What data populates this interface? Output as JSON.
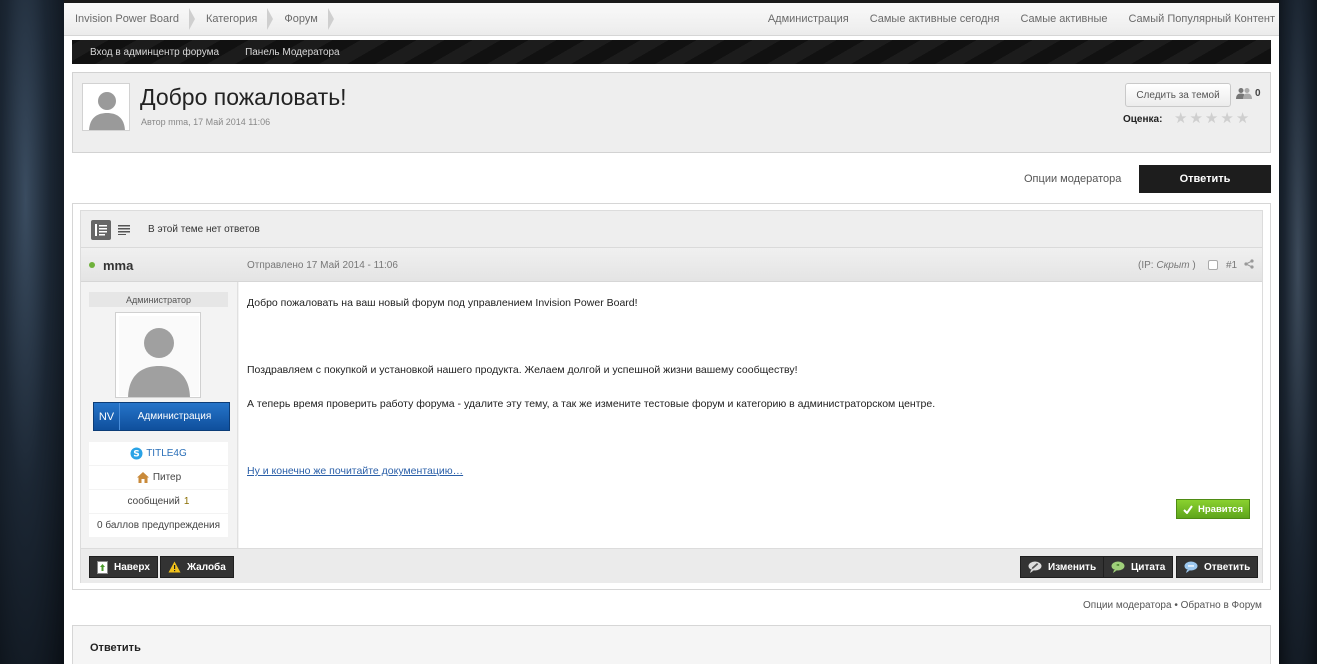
{
  "breadcrumbs": [
    "Invision Power Board",
    "Категория",
    "Форум"
  ],
  "top_links": [
    "Администрация",
    "Самые активные сегодня",
    "Самые активные",
    "Самый Популярный Контент"
  ],
  "sub_bar": {
    "admin_link": "Вход в админцентр форума",
    "mod_link": "Панель Модератора"
  },
  "topic": {
    "title": "Добро пожаловать!",
    "meta": "Автор mma, 17 Май 2014 11:06",
    "follow_label": "Следить за темой",
    "followers_count": "0",
    "rating_label": "Оценка:",
    "rating_stars": 0,
    "rating_max": 5
  },
  "actions": {
    "mod_options": "Опции модератора",
    "reply": "Ответить"
  },
  "mod_bar": {
    "no_replies": "В этой теме нет ответов"
  },
  "post": {
    "author": "mma",
    "date": "Отправлено 17 Май 2014 - 11:06",
    "ip_prefix": "(IP: ",
    "ip_value": "Скрыт",
    "ip_suffix": " )",
    "number": "#1",
    "role": "Администратор",
    "group_initials": "NV",
    "group_name": "Администрация",
    "skype": "TITLE4G",
    "location": "Питер",
    "posts_label": "сообщений",
    "posts_count": "1",
    "warnings": "0 баллов предупреждения",
    "body": [
      "Добро пожаловать на ваш новый форум под управлением Invision Power Board!",
      "Поздравляем с покупкой и установкой нашего продукта. Желаем долгой и успешной жизни вашему сообществу!",
      "А теперь время проверить работу форума - удалите эту тему, а так же измените тестовые форум и категорию в администраторском центре."
    ],
    "doc_link": "Ну и конечно же почитайте документацию…",
    "like_label": "Нравится",
    "footer_left": [
      "Наверх",
      "Жалоба"
    ],
    "footer_right": [
      "Изменить",
      "Цитата",
      "Ответить"
    ]
  },
  "bottom": {
    "mod_options": "Опции модератора",
    "separator": " • ",
    "back": "Обратно в Форум"
  },
  "reply_box": {
    "title": "Ответить"
  },
  "colors": {
    "accent_dark": "#1d1d1d",
    "group_badge": "#1a62b4",
    "like_green": "#6fb825",
    "online_dot": "#6fb13b"
  }
}
